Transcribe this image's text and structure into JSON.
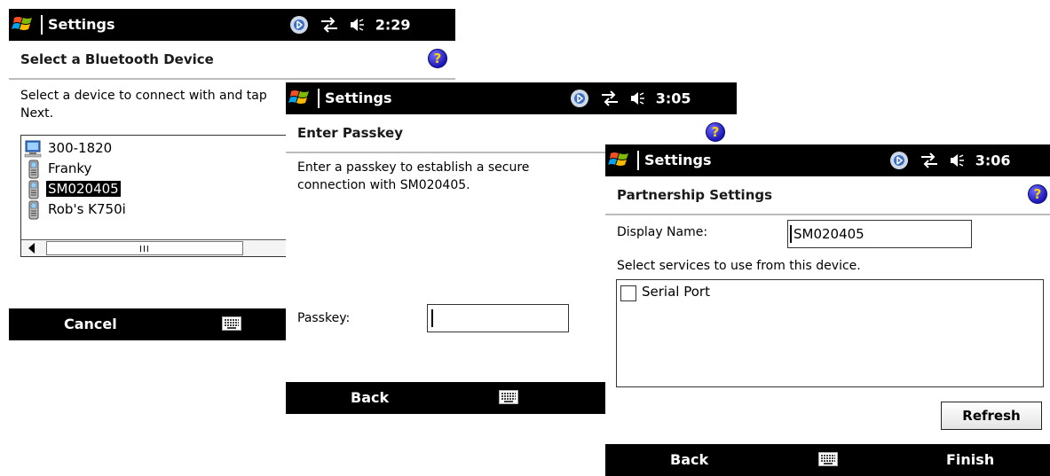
{
  "screens": [
    {
      "app_title": "Settings",
      "time": "2:29",
      "header": "Select a Bluetooth Device",
      "instruction": "Select a device to connect with and tap Next.",
      "instruction_line1": "Select a device to connect with and tap",
      "instruction_line2": "Next.",
      "devices": [
        {
          "name": "300-1820",
          "icon": "computer-icon",
          "selected": false
        },
        {
          "name": "Franky",
          "icon": "phone-icon",
          "selected": false
        },
        {
          "name": "SM020405",
          "icon": "phone-icon",
          "selected": true
        },
        {
          "name": "Rob's K750i",
          "icon": "phone-icon",
          "selected": false
        }
      ],
      "scroll_grip": "III",
      "softkey_left": "Cancel"
    },
    {
      "app_title": "Settings",
      "time": "3:05",
      "header": "Enter Passkey",
      "instruction_line1": "Enter a passkey to establish a secure",
      "instruction_line2": "connection with SM020405.",
      "passkey_label": "Passkey:",
      "passkey_value": "",
      "softkey_left": "Back"
    },
    {
      "app_title": "Settings",
      "time": "3:06",
      "header": "Partnership Settings",
      "display_name_label": "Display Name:",
      "display_name_value": "SM020405",
      "services_label": "Select services to use from this device.",
      "services": [
        {
          "label": "Serial Port",
          "checked": false
        }
      ],
      "refresh_label": "Refresh",
      "softkey_left": "Back",
      "softkey_right": "Finish"
    }
  ],
  "help_glyph": "?",
  "colors": {
    "titlebar": "#000000",
    "header_divider": "#bcbcbc",
    "help_blue": "#1d17b8",
    "help_mark": "#ffd400",
    "selection": "#000000"
  }
}
